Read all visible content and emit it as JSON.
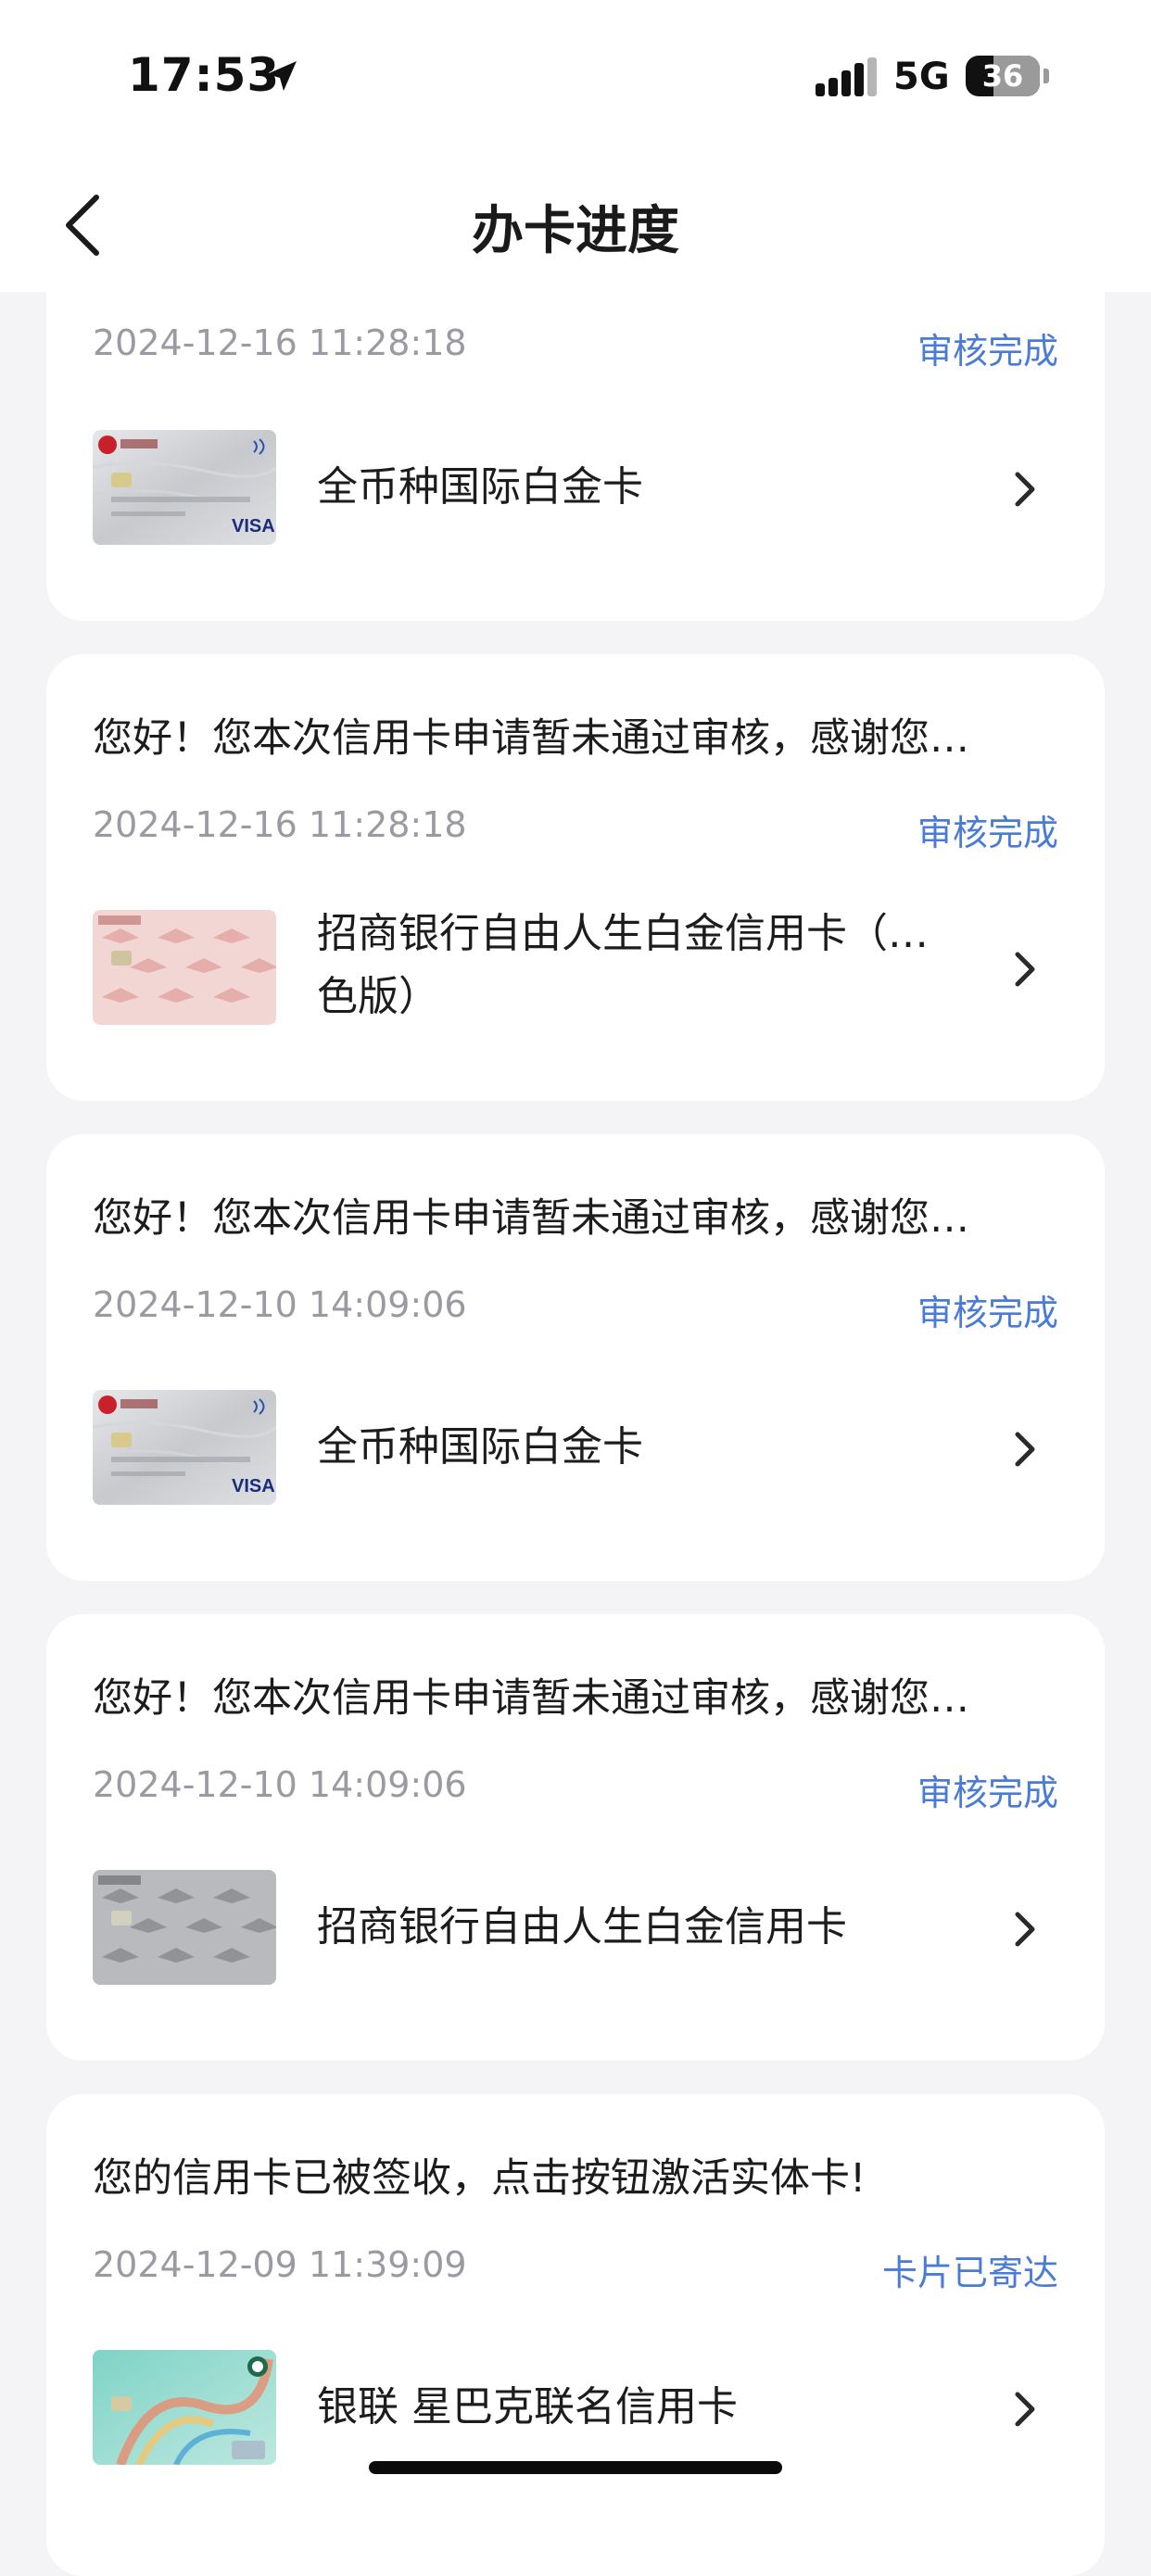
{
  "status_bar": {
    "time": "17:53",
    "network": "5G",
    "battery": "36"
  },
  "nav": {
    "title": "办卡进度",
    "back_icon": "chevron-left-icon"
  },
  "records": [
    {
      "message": "",
      "date": "2024-12-16 11:28:18",
      "status": "审核完成",
      "card_name": "全币种国际白金卡",
      "card_style": "silver-visa"
    },
    {
      "message": "您好！您本次信用卡申请暂未通过审核，感谢您…",
      "date": "2024-12-16 11:28:18",
      "status": "审核完成",
      "card_name": "招商银行自由人生白金信用卡（…",
      "card_name_line2": "色版）",
      "card_style": "pink-birds"
    },
    {
      "message": "您好！您本次信用卡申请暂未通过审核，感谢您…",
      "date": "2024-12-10 14:09:06",
      "status": "审核完成",
      "card_name": "全币种国际白金卡",
      "card_style": "silver-visa"
    },
    {
      "message": "您好！您本次信用卡申请暂未通过审核，感谢您…",
      "date": "2024-12-10 14:09:06",
      "status": "审核完成",
      "card_name": "招商银行自由人生白金信用卡",
      "card_style": "gray-birds"
    },
    {
      "message": "您的信用卡已被签收，点击按钮激活实体卡!",
      "date": "2024-12-09 11:39:09",
      "status": "卡片已寄达",
      "card_name": "银联 星巴克联名信用卡",
      "card_style": "starbucks-teal"
    }
  ],
  "colors": {
    "accent": "#4a7bd6",
    "background": "#f4f4f6",
    "card": "#ffffff",
    "date_gray": "#9a9aa2"
  }
}
